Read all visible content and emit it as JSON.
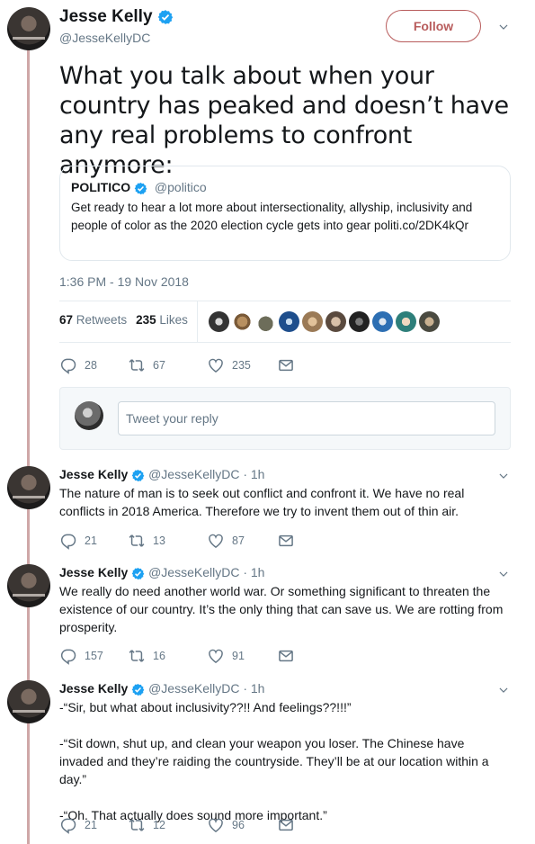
{
  "header": {
    "name": "Jesse Kelly",
    "handle": "@JesseKellyDC",
    "follow_label": "Follow"
  },
  "main_tweet": {
    "text": "What you talk about when your country has peaked and doesn’t have any real problems to confront anymore:",
    "quote": {
      "name": "POLITICO",
      "handle": "@politico",
      "text": "Get ready to hear a lot more about intersectionality, allyship, inclusivity and people of color as the 2020 election cycle gets into gear politi.co/2DK4kQr"
    },
    "timestamp": "1:36 PM - 19 Nov 2018",
    "retweets_count": "67",
    "retweets_label": "Retweets",
    "likes_count": "235",
    "likes_label": "Likes",
    "actions": {
      "replies": "28",
      "retweets": "67",
      "likes": "235"
    }
  },
  "reply_box": {
    "placeholder": "Tweet your reply"
  },
  "replies": [
    {
      "name": "Jesse Kelly",
      "handle": "@JesseKellyDC",
      "time": "· 1h",
      "lines": [
        "The nature of man is to seek out conflict and confront it. We have no real conflicts in 2018 America. Therefore we try to invent them out of thin air."
      ],
      "actions": {
        "replies": "21",
        "retweets": "13",
        "likes": "87"
      }
    },
    {
      "name": "Jesse Kelly",
      "handle": "@JesseKellyDC",
      "time": "· 1h",
      "lines": [
        "We really do need another world war. Or something significant to threaten the existence of our country. It’s the only thing that can save us. We are rotting from prosperity."
      ],
      "actions": {
        "replies": "157",
        "retweets": "16",
        "likes": "91"
      }
    },
    {
      "name": "Jesse Kelly",
      "handle": "@JesseKellyDC",
      "time": "· 1h",
      "lines": [
        "-“Sir, but what about inclusivity??!! And feelings??!!!”",
        "-“Sit down, shut up, and clean your weapon you loser. The Chinese have invaded and they’re raiding the countryside. They’ll be at our location within a day.”",
        "-“Oh. That actually does sound more important.”"
      ],
      "actions": {
        "replies": "21",
        "retweets": "12",
        "likes": "96"
      }
    }
  ],
  "colors": {
    "verified": "#1da1f2",
    "follow": "#b85c5c",
    "thread_line": "#cfa7a7",
    "muted": "#657786"
  }
}
